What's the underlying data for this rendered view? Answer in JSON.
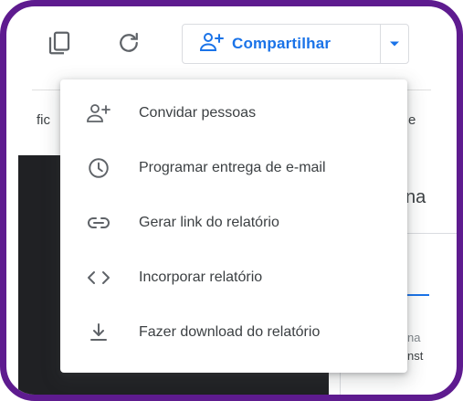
{
  "toolbar": {
    "share_label": "Compartilhar",
    "icons": [
      "copy-icon",
      "refresh-icon",
      "person-add-icon",
      "caret-down-icon"
    ]
  },
  "background": {
    "left_fragment": "fic",
    "right_fragment_1": "e",
    "right_fragment_2": "na",
    "right_fragment_3": "na",
    "right_fragment_4": "nst"
  },
  "menu": {
    "items": [
      {
        "label": "Convidar pessoas",
        "icon": "person-add-icon"
      },
      {
        "label": "Programar entrega de e-mail",
        "icon": "clock-icon"
      },
      {
        "label": "Gerar link do relatório",
        "icon": "link-icon"
      },
      {
        "label": "Incorporar relatório",
        "icon": "code-icon"
      },
      {
        "label": "Fazer download do relatório",
        "icon": "download-icon"
      }
    ]
  },
  "colors": {
    "frame": "#5e1b8f",
    "accent_blue": "#1a73e8",
    "icon_gray": "#5f6368",
    "text": "#3c4043"
  }
}
